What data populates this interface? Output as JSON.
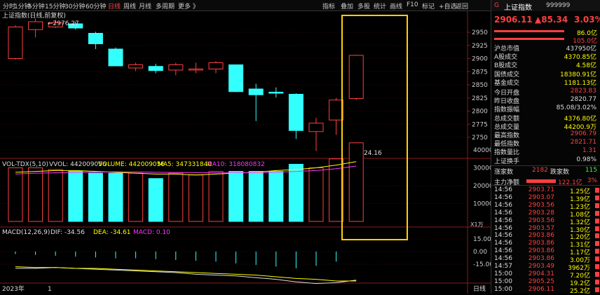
{
  "toolbar": {
    "left": [
      "分时",
      "1分钟",
      "5分钟",
      "15分钟",
      "30分钟",
      "60分钟",
      "日线",
      "周线",
      "月线",
      "多周期",
      "更多"
    ],
    "active": "日线",
    "right": [
      "指标",
      "叠加",
      "多股",
      "统计",
      "画线",
      "F10",
      "标记",
      "+自选",
      "返回"
    ]
  },
  "chart": {
    "title": "上证指数(日线,前复权)",
    "high_label": "2976.27",
    "low_label": "2724.16",
    "price_axis": [
      "2950",
      "2925",
      "2900",
      "2875",
      "2850",
      "2825",
      "2800",
      "2775",
      "2750"
    ],
    "candles": [
      {
        "o": 2900,
        "c": 2960,
        "h": 2963,
        "l": 2898
      },
      {
        "o": 2955,
        "c": 2970,
        "h": 2976,
        "l": 2940
      },
      {
        "o": 2960,
        "c": 2968,
        "h": 2974,
        "l": 2958
      },
      {
        "o": 2966,
        "c": 2958,
        "h": 2970,
        "l": 2955
      },
      {
        "o": 2948,
        "c": 2928,
        "h": 2951,
        "l": 2918
      },
      {
        "o": 2918,
        "c": 2886,
        "h": 2921,
        "l": 2886
      },
      {
        "o": 2882,
        "c": 2888,
        "h": 2892,
        "l": 2876
      },
      {
        "o": 2885,
        "c": 2877,
        "h": 2890,
        "l": 2872
      },
      {
        "o": 2878,
        "c": 2888,
        "h": 2892,
        "l": 2868
      },
      {
        "o": 2878,
        "c": 2880,
        "h": 2892,
        "l": 2872
      },
      {
        "o": 2880,
        "c": 2892,
        "h": 2895,
        "l": 2872
      },
      {
        "o": 2888,
        "c": 2837,
        "h": 2888,
        "l": 2836
      },
      {
        "o": 2842,
        "c": 2831,
        "h": 2852,
        "l": 2781
      },
      {
        "o": 2836,
        "c": 2834,
        "h": 2845,
        "l": 2826
      },
      {
        "o": 2832,
        "c": 2763,
        "h": 2834,
        "l": 2747
      },
      {
        "o": 2761,
        "c": 2777,
        "h": 2787,
        "l": 2724
      },
      {
        "o": 2783,
        "c": 2821,
        "h": 2825,
        "l": 2755
      },
      {
        "o": 2824,
        "c": 2906,
        "h": 2907,
        "l": 2821
      }
    ],
    "vol_title": "VOL-TDX(5,10)",
    "vvol": "VVOL: 442009056",
    "volume": "VOLUME: 442009056",
    "ma5": "MA5: 347331840",
    "ma10": "MA10: 318080832",
    "vol_axis": [
      "40000",
      "30000",
      "20000",
      "10000"
    ],
    "vol_unit": "X1万",
    "volumes": [
      30000,
      30000,
      29000,
      28000,
      27000,
      27000,
      27000,
      24000,
      27000,
      26000,
      28000,
      28000,
      28000,
      28000,
      32000,
      30000,
      35000,
      44000
    ],
    "macd_title": "MACD(12,26,9)",
    "dif": "DIF: -34.56",
    "dea": "DEA: -34.61",
    "macd": "MACD: 0.10",
    "macd_axis": [
      "15.00",
      "0.00",
      "-15.00"
    ],
    "year": "2023年",
    "month": "1",
    "period": "日线"
  },
  "quote": {
    "logo": "G",
    "name": "上证指数",
    "code": "999999",
    "price": "2906.11",
    "change": "▲85.34",
    "pct": "3.03%",
    "ratio1": "86.0亿",
    "ratio2": "105.0亿"
  },
  "stats": [
    {
      "l": "沪总市值",
      "v": "437950亿",
      "c": "#ddd"
    },
    {
      "l": "A股成交",
      "v": "4370.85亿",
      "c": "#ff0"
    },
    {
      "l": "B股成交",
      "v": "4.58亿",
      "c": "#ff0"
    },
    {
      "l": "国债成交",
      "v": "18380.91亿",
      "c": "#ff0"
    },
    {
      "l": "基金成交",
      "v": "1181.13亿",
      "c": "#ff0"
    },
    {
      "l": "今日开盘",
      "v": "2823.83",
      "c": "#ff4040"
    },
    {
      "l": "昨日收盘",
      "v": "2820.77",
      "c": "#ddd"
    },
    {
      "l": "指数振幅",
      "v": "85.08/3.02%",
      "c": "#ddd"
    },
    {
      "l": "总成交额",
      "v": "4376.80亿",
      "c": "#ff0"
    },
    {
      "l": "总成交量",
      "v": "44200.9万",
      "c": "#ff0"
    },
    {
      "l": "最高指数",
      "v": "2906.79",
      "c": "#ff4040"
    },
    {
      "l": "最低指数",
      "v": "2821.71",
      "c": "#ff4040"
    },
    {
      "l": "指数量比",
      "v": "1.31",
      "c": "#ff4040"
    },
    {
      "l": "上证换手",
      "v": "0.98%",
      "c": "#ddd"
    }
  ],
  "breadth": {
    "up_label": "涨家数",
    "up": "2182",
    "down_label": "跌家数",
    "down": "115"
  },
  "flow": {
    "label": "主力净额",
    "value": "122.1亿",
    "pct": "3%"
  },
  "ticks": [
    {
      "t": "14:56",
      "p": "2903.71",
      "q": "1.25亿"
    },
    {
      "t": "14:56",
      "p": "2903.07",
      "q": "1.39亿"
    },
    {
      "t": "14:56",
      "p": "2903.56",
      "q": "1.23亿"
    },
    {
      "t": "14:56",
      "p": "2903.28",
      "q": "1.08亿"
    },
    {
      "t": "14:56",
      "p": "2903.56",
      "q": "1.32亿"
    },
    {
      "t": "14:56",
      "p": "2903.57",
      "q": "1.30亿"
    },
    {
      "t": "14:56",
      "p": "2903.86",
      "q": "1.20亿"
    },
    {
      "t": "14:56",
      "p": "2903.86",
      "q": "1.31亿"
    },
    {
      "t": "14:56",
      "p": "2903.86",
      "q": "1.17亿"
    },
    {
      "t": "14:56",
      "p": "2903.86",
      "q": "3.00万"
    },
    {
      "t": "14:57",
      "p": "2903.49",
      "q": "3962万"
    },
    {
      "t": "15:00",
      "p": "2904.31",
      "q": "7.20亿"
    },
    {
      "t": "15:00",
      "p": "2905.25",
      "q": "19.2亿"
    },
    {
      "t": "15:00",
      "p": "2906.11",
      "q": "25.2亿"
    }
  ]
}
